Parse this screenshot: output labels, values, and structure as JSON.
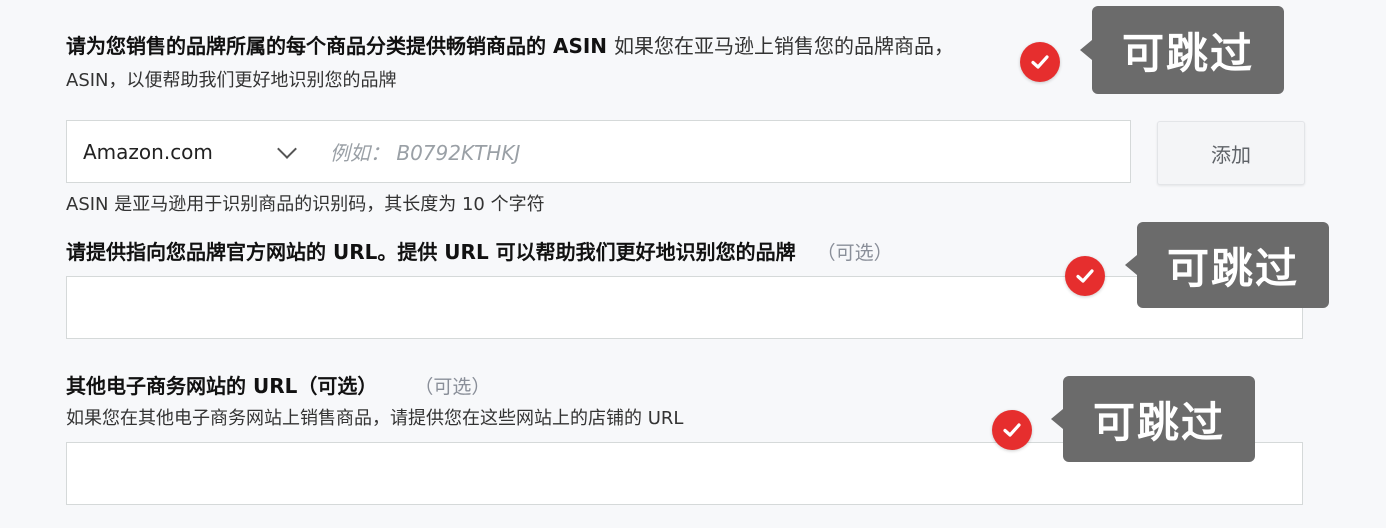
{
  "section1": {
    "heading_bold": "请为您销售的品牌所属的每个商品分类提供畅销商品的 ASIN",
    "heading_rest": "如果您在亚马逊上销售您的品牌商品，",
    "subline": "ASIN，以便帮助我们更好地识别您的品牌",
    "marketplace_select": "Amazon.com",
    "asin_placeholder": "例如：  B0792KTHKJ",
    "add_button": "添加",
    "hint": "ASIN 是亚马逊用于识别商品的识别码，其长度为 10 个字符"
  },
  "section2": {
    "heading": "请提供指向您品牌官方网站的 URL。提供 URL 可以帮助我们更好地识别您的品牌",
    "optional": "（可选）",
    "url_value": ""
  },
  "section3": {
    "heading": "其他电子商务网站的 URL（可选）",
    "optional": "（可选）",
    "description": "如果您在其他电子商务网站上销售商品，请提供您在这些网站上的店铺的 URL",
    "url_value": ""
  },
  "annotations": {
    "skip_label": "可跳过",
    "badge_color": "#e62e2e",
    "callout_color": "#6b6b6b",
    "badge_icon": "checkmark-icon"
  }
}
